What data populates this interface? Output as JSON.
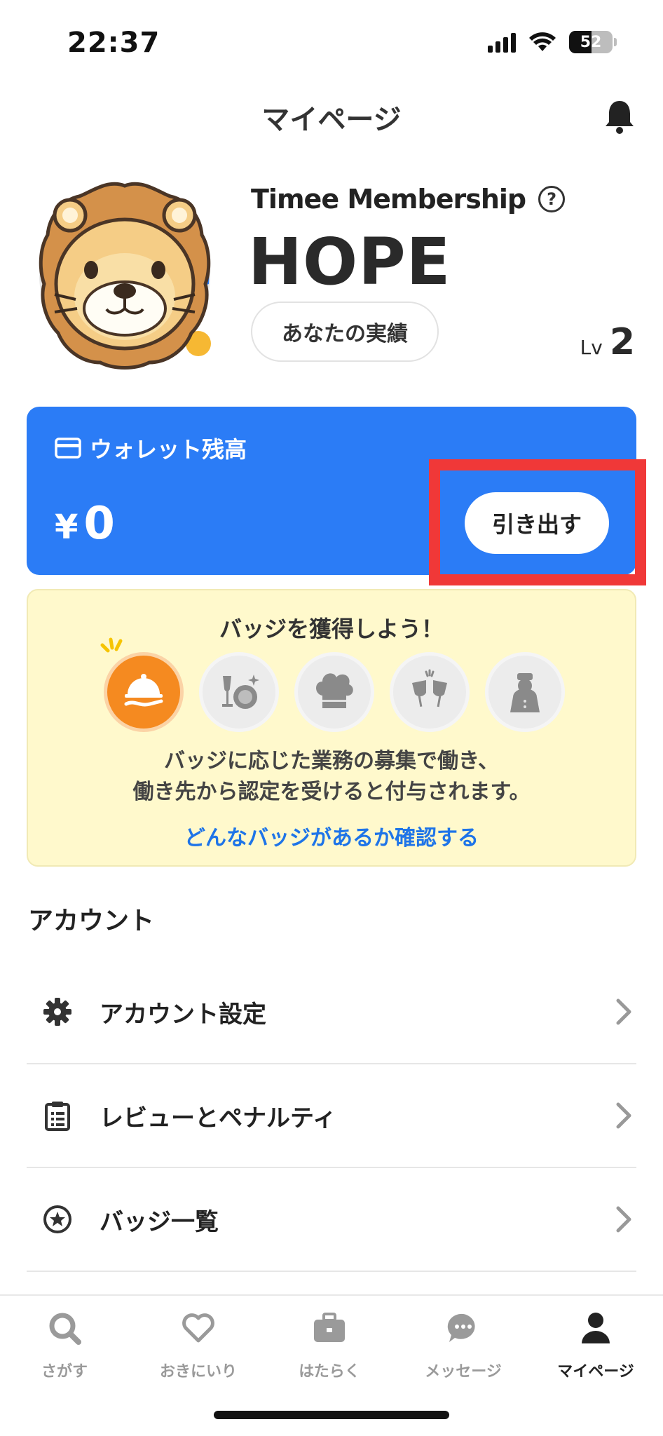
{
  "status_bar": {
    "time": "22:37",
    "battery": "52",
    "battery_level": 0.52
  },
  "header": {
    "title": "マイページ"
  },
  "profile": {
    "membership_label": "Timee Membership",
    "help_symbol": "?",
    "rank": "HOPE",
    "achievements_button": "あなたの実績",
    "level_label": "Lv",
    "level_value": "2"
  },
  "wallet": {
    "label": "ウォレット残高",
    "currency": "¥",
    "amount": "0",
    "withdraw_button": "引き出す",
    "color": "#2b7cf6"
  },
  "badges": {
    "title": "バッジを獲得しよう！",
    "items": [
      {
        "icon": "serving-cloche-icon",
        "active": true
      },
      {
        "icon": "wine-and-plate-icon",
        "active": false
      },
      {
        "icon": "chef-hat-icon",
        "active": false
      },
      {
        "icon": "toast-glasses-icon",
        "active": false
      },
      {
        "icon": "bellhop-icon",
        "active": false
      }
    ],
    "description_line1": "バッジに応じた業務の募集で働き、",
    "description_line2": "働き先から認定を受けると付与されます。",
    "link": "どんなバッジがあるか確認する"
  },
  "account": {
    "section_title": "アカウント",
    "items": [
      {
        "icon": "gear-icon",
        "label": "アカウント設定"
      },
      {
        "icon": "clipboard-icon",
        "label": "レビューとペナルティ"
      },
      {
        "icon": "star-circle-icon",
        "label": "バッジ一覧"
      }
    ]
  },
  "tabbar": {
    "items": [
      {
        "icon": "search-icon",
        "label": "さがす",
        "active": false
      },
      {
        "icon": "heart-icon",
        "label": "おきにいり",
        "active": false
      },
      {
        "icon": "briefcase-icon",
        "label": "はたらく",
        "active": false
      },
      {
        "icon": "chat-bubble-icon",
        "label": "メッセージ",
        "active": false
      },
      {
        "icon": "person-icon",
        "label": "マイページ",
        "active": true
      }
    ]
  },
  "highlight_color": "#f03838"
}
